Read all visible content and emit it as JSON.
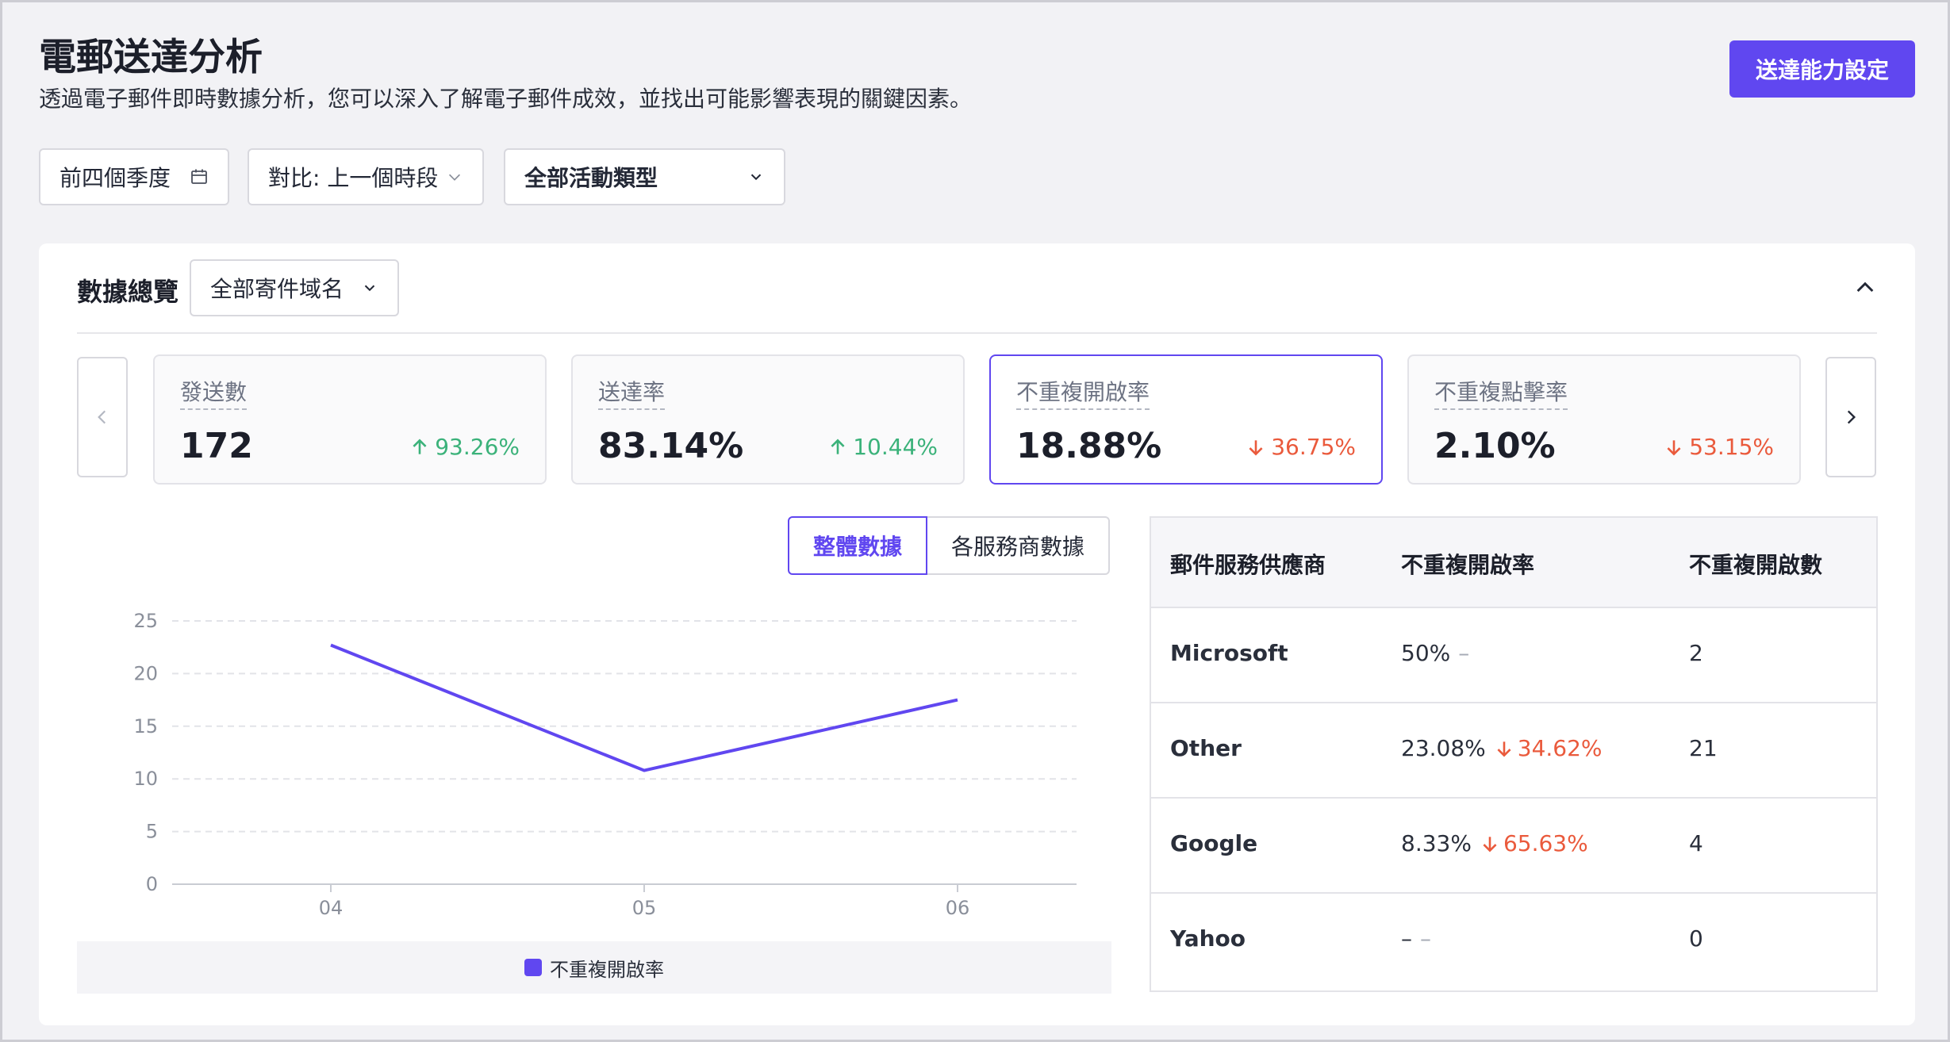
{
  "header": {
    "title": "電郵送達分析",
    "subtitle": "透過電子郵件即時數據分析，您可以深入了解電子郵件成效，並找出可能影響表現的關鍵因素。",
    "settings_button": "送達能力設定"
  },
  "filters": {
    "period": "前四個季度",
    "compare": "對比: 上一個時段",
    "campaign_type": "全部活動類型"
  },
  "overview": {
    "title": "數據總覽",
    "domain_select": "全部寄件域名"
  },
  "metrics": [
    {
      "label": "發送數",
      "value": "172",
      "change": "93.26%",
      "direction": "up"
    },
    {
      "label": "送達率",
      "value": "83.14%",
      "change": "10.44%",
      "direction": "up"
    },
    {
      "label": "不重複開啟率",
      "value": "18.88%",
      "change": "36.75%",
      "direction": "down"
    },
    {
      "label": "不重複點擊率",
      "value": "2.10%",
      "change": "53.15%",
      "direction": "down"
    }
  ],
  "toggle": {
    "overall": "整體數據",
    "by_provider": "各服務商數據"
  },
  "chart_data": {
    "type": "line",
    "x": [
      "04",
      "05",
      "06"
    ],
    "series": [
      {
        "name": "不重複開啟率",
        "values": [
          22.7,
          10.8,
          17.5
        ]
      }
    ],
    "yticks": [
      "0",
      "5",
      "10",
      "15",
      "20",
      "25"
    ],
    "ylim": [
      0,
      25
    ],
    "grid": true,
    "legend_position": "bottom",
    "color": "#6047f0"
  },
  "table": {
    "headers": [
      "郵件服務供應商",
      "不重複開啟率",
      "不重複開啟數"
    ],
    "rows": [
      {
        "provider": "Microsoft",
        "rate": "50%",
        "change": "–",
        "change_dir": "none",
        "count": "2"
      },
      {
        "provider": "Other",
        "rate": "23.08%",
        "change": "34.62%",
        "change_dir": "down",
        "count": "21"
      },
      {
        "provider": "Google",
        "rate": "8.33%",
        "change": "65.63%",
        "change_dir": "down",
        "count": "4"
      },
      {
        "provider": "Yahoo",
        "rate": "–",
        "change": "–",
        "change_dir": "none",
        "count": "0"
      }
    ]
  },
  "colors": {
    "accent": "#6047f0",
    "up": "#3bb27a",
    "down": "#ea5a3c"
  }
}
